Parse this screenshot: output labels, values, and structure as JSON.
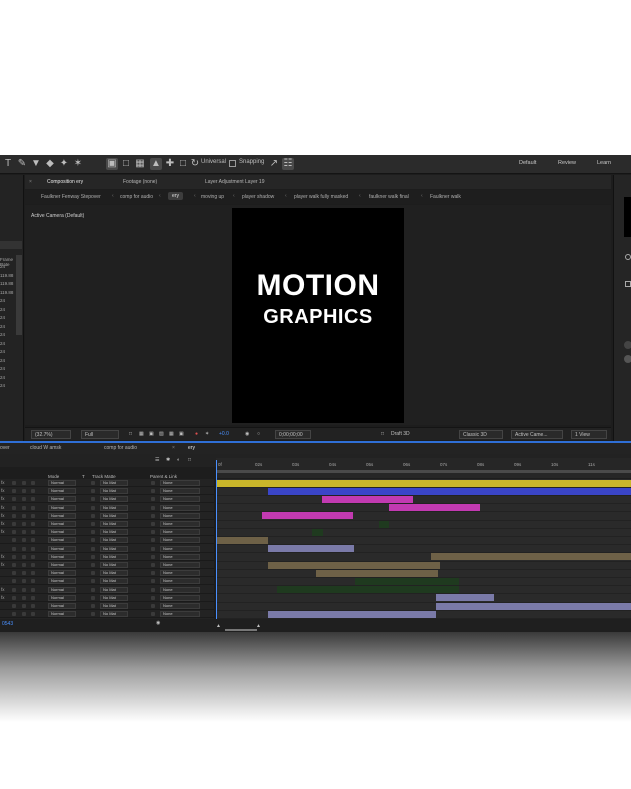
{
  "toolbar": {
    "tools": [
      "text-tool-icon",
      "pen-tool-icon",
      "stamp-tool-icon",
      "eraser-tool-icon",
      "roto-brush-icon",
      "puppet-tool-icon"
    ],
    "universal_label": "Universal",
    "snapping_label": "Snapping",
    "workspaces": [
      "Default",
      "Review",
      "Learn"
    ]
  },
  "project_panel": {
    "frame_rate_label": "Frame Rate",
    "rows": [
      "24",
      "119.88",
      "119.88",
      "119.88",
      "24",
      "24",
      "24",
      "24",
      "24",
      "24",
      "24",
      "24",
      "24",
      "24",
      "24"
    ]
  },
  "comp_tabs": {
    "composition": "Composition ery",
    "footage": "Footage (none)",
    "layer": "Layer Adjustment Layer 19"
  },
  "breadcrumbs": [
    "Faulkner Fenway Stepover",
    "comp for audio",
    "ery",
    "moving up",
    "player shadow",
    "player walk fully masked",
    "faulkner walk final",
    "Faulkner walk"
  ],
  "viewer": {
    "camera_label": "Active Camera (Default)",
    "title_line1": "MOTION",
    "title_line2": "GRAPHICS"
  },
  "viewer_bar": {
    "zoom": "(32.7%)",
    "resolution": "Full",
    "exposure": "+0.0",
    "timecode": "0;00;00;00",
    "draft3d": "Draft 3D",
    "renderer": "Classic 3D",
    "camera": "Active Came...",
    "views": "1 View"
  },
  "timeline": {
    "tabs": [
      "over",
      "cloud W amsk",
      "comp for audio",
      "ery"
    ],
    "columns": {
      "mode": "Mode",
      "t": "T",
      "track_matte": "Track Matte",
      "parent": "Parent & Link"
    },
    "ruler_labels": [
      "0f",
      "02s",
      "03s",
      "04s",
      "05s",
      "06s",
      "07s",
      "08s",
      "09s",
      "10s",
      "11s"
    ],
    "layers": [
      {
        "fx": "fx",
        "mode": "Normal",
        "matte": "No Mat",
        "parent": "None"
      },
      {
        "fx": "fx",
        "mode": "Normal",
        "matte": "No Mat",
        "parent": "None"
      },
      {
        "fx": "fx",
        "mode": "Normal",
        "matte": "No Mat",
        "parent": "None"
      },
      {
        "fx": "fx",
        "mode": "Normal",
        "matte": "No Mat",
        "parent": "None"
      },
      {
        "fx": "fx",
        "mode": "Normal",
        "matte": "No Mat",
        "parent": "None"
      },
      {
        "fx": "fx",
        "mode": "Normal",
        "matte": "No Mat",
        "parent": "None"
      },
      {
        "fx": "fx",
        "mode": "Normal",
        "matte": "No Mat",
        "parent": "None"
      },
      {
        "fx": "",
        "mode": "Normal",
        "matte": "No Mat",
        "parent": "None"
      },
      {
        "fx": "",
        "mode": "Normal",
        "matte": "No Mat",
        "parent": "None"
      },
      {
        "fx": "fx",
        "mode": "Normal",
        "matte": "No Mat",
        "parent": "None"
      },
      {
        "fx": "fx",
        "mode": "Normal",
        "matte": "No Mat",
        "parent": "None"
      },
      {
        "fx": "",
        "mode": "Normal",
        "matte": "No Mat",
        "parent": "None"
      },
      {
        "fx": "",
        "mode": "Normal",
        "matte": "No Mat",
        "parent": "None"
      },
      {
        "fx": "fx",
        "mode": "Normal",
        "matte": "No Mat",
        "parent": "None"
      },
      {
        "fx": "fx",
        "mode": "Normal",
        "matte": "No Mat",
        "parent": "None"
      },
      {
        "fx": "",
        "mode": "Normal",
        "matte": "No Mat",
        "parent": "None"
      },
      {
        "fx": "",
        "mode": "Normal",
        "matte": "No Mat",
        "parent": "None"
      }
    ],
    "footer_time": "0543"
  },
  "colors": {
    "bar_yellow": "#c9b62a",
    "bar_blue": "#3a45c8",
    "bar_magenta": "#c23ab1",
    "bar_green": "#1f3a1f",
    "bar_tan": "#6e6147",
    "bar_lavender": "#7a7aa8",
    "accent_blue": "#4a90ff"
  }
}
